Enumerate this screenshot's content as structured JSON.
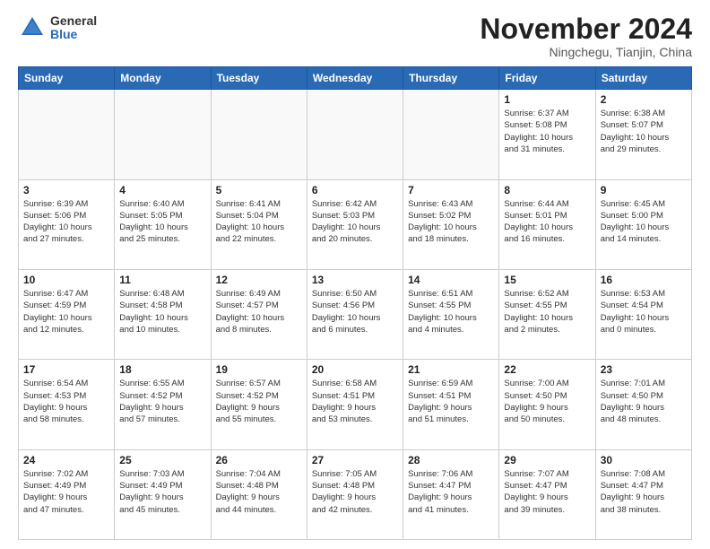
{
  "logo": {
    "general": "General",
    "blue": "Blue"
  },
  "title": "November 2024",
  "location": "Ningchegu, Tianjin, China",
  "days_of_week": [
    "Sunday",
    "Monday",
    "Tuesday",
    "Wednesday",
    "Thursday",
    "Friday",
    "Saturday"
  ],
  "weeks": [
    [
      {
        "day": "",
        "info": ""
      },
      {
        "day": "",
        "info": ""
      },
      {
        "day": "",
        "info": ""
      },
      {
        "day": "",
        "info": ""
      },
      {
        "day": "",
        "info": ""
      },
      {
        "day": "1",
        "info": "Sunrise: 6:37 AM\nSunset: 5:08 PM\nDaylight: 10 hours\nand 31 minutes."
      },
      {
        "day": "2",
        "info": "Sunrise: 6:38 AM\nSunset: 5:07 PM\nDaylight: 10 hours\nand 29 minutes."
      }
    ],
    [
      {
        "day": "3",
        "info": "Sunrise: 6:39 AM\nSunset: 5:06 PM\nDaylight: 10 hours\nand 27 minutes."
      },
      {
        "day": "4",
        "info": "Sunrise: 6:40 AM\nSunset: 5:05 PM\nDaylight: 10 hours\nand 25 minutes."
      },
      {
        "day": "5",
        "info": "Sunrise: 6:41 AM\nSunset: 5:04 PM\nDaylight: 10 hours\nand 22 minutes."
      },
      {
        "day": "6",
        "info": "Sunrise: 6:42 AM\nSunset: 5:03 PM\nDaylight: 10 hours\nand 20 minutes."
      },
      {
        "day": "7",
        "info": "Sunrise: 6:43 AM\nSunset: 5:02 PM\nDaylight: 10 hours\nand 18 minutes."
      },
      {
        "day": "8",
        "info": "Sunrise: 6:44 AM\nSunset: 5:01 PM\nDaylight: 10 hours\nand 16 minutes."
      },
      {
        "day": "9",
        "info": "Sunrise: 6:45 AM\nSunset: 5:00 PM\nDaylight: 10 hours\nand 14 minutes."
      }
    ],
    [
      {
        "day": "10",
        "info": "Sunrise: 6:47 AM\nSunset: 4:59 PM\nDaylight: 10 hours\nand 12 minutes."
      },
      {
        "day": "11",
        "info": "Sunrise: 6:48 AM\nSunset: 4:58 PM\nDaylight: 10 hours\nand 10 minutes."
      },
      {
        "day": "12",
        "info": "Sunrise: 6:49 AM\nSunset: 4:57 PM\nDaylight: 10 hours\nand 8 minutes."
      },
      {
        "day": "13",
        "info": "Sunrise: 6:50 AM\nSunset: 4:56 PM\nDaylight: 10 hours\nand 6 minutes."
      },
      {
        "day": "14",
        "info": "Sunrise: 6:51 AM\nSunset: 4:55 PM\nDaylight: 10 hours\nand 4 minutes."
      },
      {
        "day": "15",
        "info": "Sunrise: 6:52 AM\nSunset: 4:55 PM\nDaylight: 10 hours\nand 2 minutes."
      },
      {
        "day": "16",
        "info": "Sunrise: 6:53 AM\nSunset: 4:54 PM\nDaylight: 10 hours\nand 0 minutes."
      }
    ],
    [
      {
        "day": "17",
        "info": "Sunrise: 6:54 AM\nSunset: 4:53 PM\nDaylight: 9 hours\nand 58 minutes."
      },
      {
        "day": "18",
        "info": "Sunrise: 6:55 AM\nSunset: 4:52 PM\nDaylight: 9 hours\nand 57 minutes."
      },
      {
        "day": "19",
        "info": "Sunrise: 6:57 AM\nSunset: 4:52 PM\nDaylight: 9 hours\nand 55 minutes."
      },
      {
        "day": "20",
        "info": "Sunrise: 6:58 AM\nSunset: 4:51 PM\nDaylight: 9 hours\nand 53 minutes."
      },
      {
        "day": "21",
        "info": "Sunrise: 6:59 AM\nSunset: 4:51 PM\nDaylight: 9 hours\nand 51 minutes."
      },
      {
        "day": "22",
        "info": "Sunrise: 7:00 AM\nSunset: 4:50 PM\nDaylight: 9 hours\nand 50 minutes."
      },
      {
        "day": "23",
        "info": "Sunrise: 7:01 AM\nSunset: 4:50 PM\nDaylight: 9 hours\nand 48 minutes."
      }
    ],
    [
      {
        "day": "24",
        "info": "Sunrise: 7:02 AM\nSunset: 4:49 PM\nDaylight: 9 hours\nand 47 minutes."
      },
      {
        "day": "25",
        "info": "Sunrise: 7:03 AM\nSunset: 4:49 PM\nDaylight: 9 hours\nand 45 minutes."
      },
      {
        "day": "26",
        "info": "Sunrise: 7:04 AM\nSunset: 4:48 PM\nDaylight: 9 hours\nand 44 minutes."
      },
      {
        "day": "27",
        "info": "Sunrise: 7:05 AM\nSunset: 4:48 PM\nDaylight: 9 hours\nand 42 minutes."
      },
      {
        "day": "28",
        "info": "Sunrise: 7:06 AM\nSunset: 4:47 PM\nDaylight: 9 hours\nand 41 minutes."
      },
      {
        "day": "29",
        "info": "Sunrise: 7:07 AM\nSunset: 4:47 PM\nDaylight: 9 hours\nand 39 minutes."
      },
      {
        "day": "30",
        "info": "Sunrise: 7:08 AM\nSunset: 4:47 PM\nDaylight: 9 hours\nand 38 minutes."
      }
    ]
  ]
}
